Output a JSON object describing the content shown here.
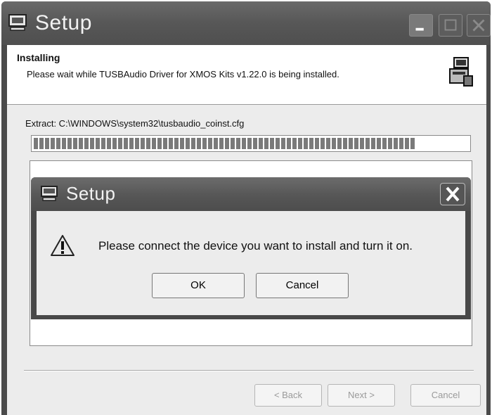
{
  "window": {
    "title": "Setup",
    "icon": "setup-window-icon"
  },
  "header": {
    "title": "Installing",
    "subtitle": "Please wait while TUSBAudio Driver for XMOS Kits v1.22.0 is being installed.",
    "icon": "installer-icon"
  },
  "progress": {
    "label": "Extract: C:\\WINDOWS\\system32\\tusbaudio_coinst.cfg",
    "percent": 88
  },
  "buttons": {
    "back": "< Back",
    "next": "Next >",
    "cancel": "Cancel"
  },
  "dialog": {
    "title": "Setup",
    "message": "Please connect the device you want to install and turn it on.",
    "ok_label": "OK",
    "cancel_label": "Cancel",
    "icon": "warning-icon"
  }
}
